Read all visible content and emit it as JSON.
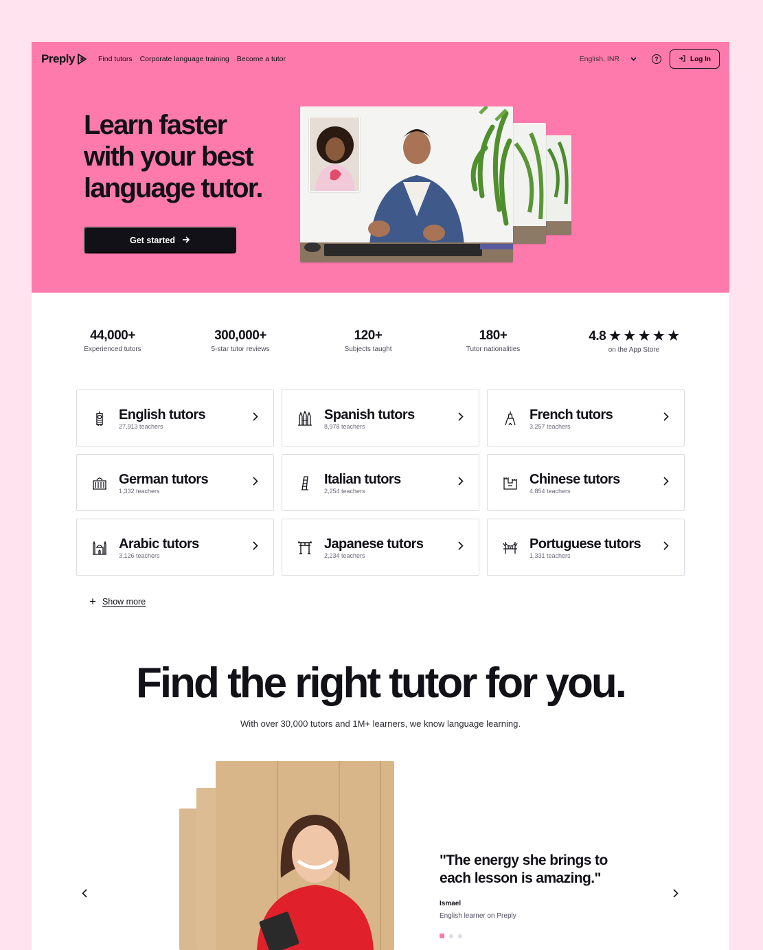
{
  "nav": {
    "logo": "Preply",
    "links": [
      "Find tutors",
      "Corporate language training",
      "Become a tutor"
    ],
    "language": "English, INR",
    "help": "?",
    "login": "Log In"
  },
  "hero": {
    "title_lines": [
      "Learn faster",
      "with your best",
      "language tutor."
    ],
    "cta": "Get started"
  },
  "stats": [
    {
      "value": "44,000+",
      "label": "Experienced tutors"
    },
    {
      "value": "300,000+",
      "label": "5-star tutor reviews"
    },
    {
      "value": "120+",
      "label": "Subjects taught"
    },
    {
      "value": "180+",
      "label": "Tutor nationalities"
    },
    {
      "value": "4.8 ★ ★ ★ ★ ★",
      "label": "on the App Store"
    }
  ],
  "tutors": [
    {
      "title": "English tutors",
      "count": "27,913 teachers",
      "icon": "big-ben-icon"
    },
    {
      "title": "Spanish tutors",
      "count": "8,978 teachers",
      "icon": "sagrada-familia-icon"
    },
    {
      "title": "French tutors",
      "count": "3,257 teachers",
      "icon": "eiffel-tower-icon"
    },
    {
      "title": "German tutors",
      "count": "1,332 teachers",
      "icon": "reichstag-icon"
    },
    {
      "title": "Italian tutors",
      "count": "2,254 teachers",
      "icon": "leaning-tower-icon"
    },
    {
      "title": "Chinese tutors",
      "count": "4,854 teachers",
      "icon": "great-wall-icon"
    },
    {
      "title": "Arabic tutors",
      "count": "3,126 teachers",
      "icon": "mosque-icon"
    },
    {
      "title": "Japanese tutors",
      "count": "2,234 teachers",
      "icon": "torii-gate-icon"
    },
    {
      "title": "Portuguese tutors",
      "count": "1,331 teachers",
      "icon": "bridge-icon"
    }
  ],
  "show_more": "Show more",
  "find": {
    "title": "Find the right tutor for you.",
    "subtitle": "With over 30,000 tutors and 1M+ learners, we know language learning."
  },
  "testimonial": {
    "quote_lines": [
      "\"The energy she brings to",
      "each lesson is amazing.\""
    ],
    "author": "Ismael",
    "author_sub": "English learner on Preply",
    "active_slide": 1,
    "slides": 3
  },
  "colors": {
    "brand_pink": "#ff7aac",
    "ink": "#121117",
    "page_bg": "#ffe3ee"
  }
}
